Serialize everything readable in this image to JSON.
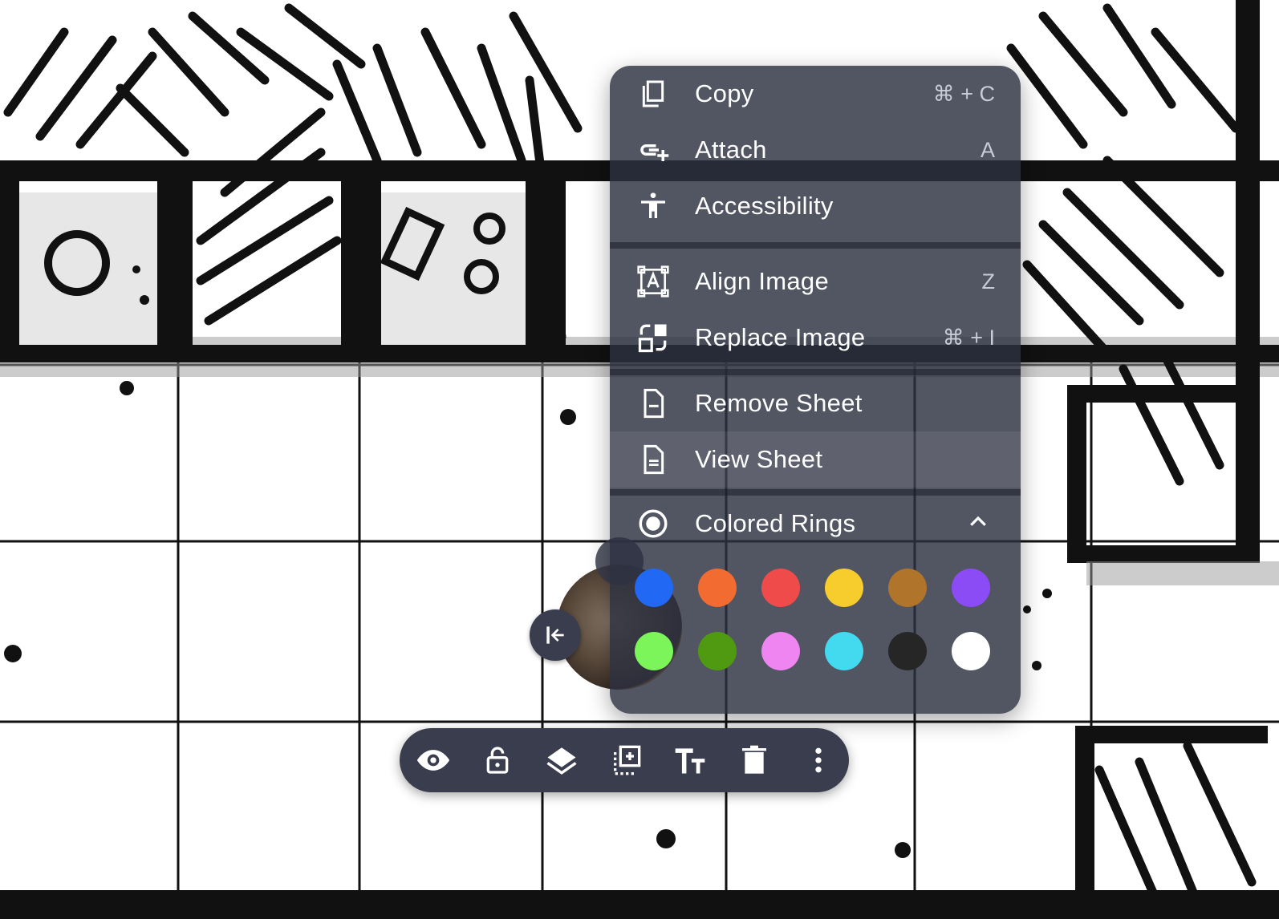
{
  "menu": {
    "items": [
      {
        "label": "Copy",
        "shortcut": "⌘ + C",
        "icon": "copy-icon"
      },
      {
        "label": "Attach",
        "shortcut": "A",
        "icon": "attach-icon"
      },
      {
        "label": "Accessibility",
        "shortcut": "",
        "icon": "accessibility-icon"
      },
      {
        "label": "Align Image",
        "shortcut": "Z",
        "icon": "align-image-icon"
      },
      {
        "label": "Replace Image",
        "shortcut": "⌘ + I",
        "icon": "replace-image-icon"
      },
      {
        "label": "Remove Sheet",
        "shortcut": "",
        "icon": "remove-sheet-icon"
      },
      {
        "label": "View Sheet",
        "shortcut": "",
        "icon": "view-sheet-icon"
      },
      {
        "label": "Colored Rings",
        "shortcut": "",
        "icon": "colored-rings-icon"
      }
    ],
    "ring_colors": [
      "#2168f5",
      "#f26b30",
      "#f04b4b",
      "#f7cd2d",
      "#b0742a",
      "#8c4cf5",
      "#7cf55a",
      "#4f9a11",
      "#ee85f0",
      "#43daf0",
      "#262626",
      "#ffffff"
    ]
  },
  "toolbar": {
    "buttons": [
      "eye-icon",
      "unlock-icon",
      "layers-icon",
      "duplicate-icon",
      "text-size-icon",
      "trash-icon",
      "more-vertical-icon"
    ]
  },
  "colors": {
    "menu_bg": "#2c2f40",
    "toolbar_bg": "#3a3d4e",
    "text": "#ffffff"
  }
}
